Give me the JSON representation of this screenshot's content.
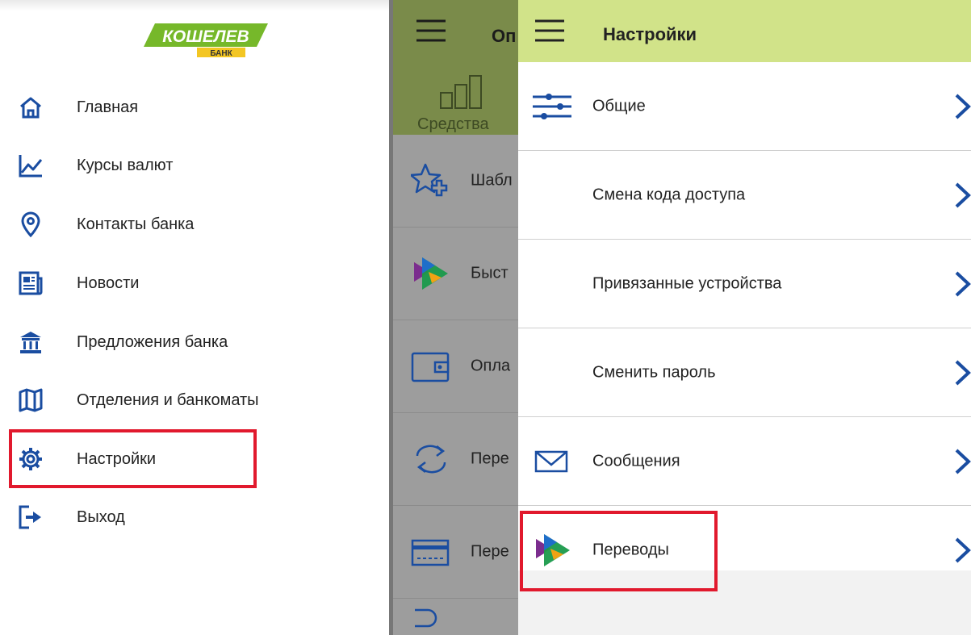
{
  "drawer": {
    "logo": {
      "brand": "КОШЕЛЕВ",
      "sub": "БАНК"
    },
    "items": [
      {
        "label": "Главная",
        "icon": "home-icon"
      },
      {
        "label": "Курсы валют",
        "icon": "chart-line-icon"
      },
      {
        "label": "Контакты банка",
        "icon": "location-pin-icon"
      },
      {
        "label": "Новости",
        "icon": "newspaper-icon"
      },
      {
        "label": "Предложения банка",
        "icon": "bank-building-icon"
      },
      {
        "label": "Отделения и банкоматы",
        "icon": "map-icon"
      },
      {
        "label": "Настройки",
        "icon": "gear-icon",
        "highlighted": true
      },
      {
        "label": "Выход",
        "icon": "logout-icon"
      }
    ]
  },
  "middle": {
    "header_title": "Оп",
    "tab_label": "Средства",
    "rows": [
      {
        "label": "Шабл",
        "icon": "star-plus-icon"
      },
      {
        "label": "Быст",
        "icon": "fast-payment-icon"
      },
      {
        "label": "Опла",
        "icon": "wallet-icon"
      },
      {
        "label": "Пере",
        "icon": "transfer-arrows-icon"
      },
      {
        "label": "Пере",
        "icon": "card-icon"
      }
    ]
  },
  "settings": {
    "title": "Настройки",
    "rows": [
      {
        "label": "Общие",
        "icon": "sliders-icon"
      },
      {
        "label": "Смена кода доступа",
        "icon": ""
      },
      {
        "label": "Привязанные устройства",
        "icon": ""
      },
      {
        "label": "Сменить пароль",
        "icon": ""
      },
      {
        "label": "Сообщения",
        "icon": "envelope-icon"
      },
      {
        "label": "Переводы",
        "icon": "fast-payment-icon",
        "highlighted": true
      }
    ]
  },
  "colors": {
    "accent_blue": "#1a4da1",
    "header_green": "#d1e389",
    "highlight_red": "#e1192d",
    "logo_green": "#76b82a"
  }
}
